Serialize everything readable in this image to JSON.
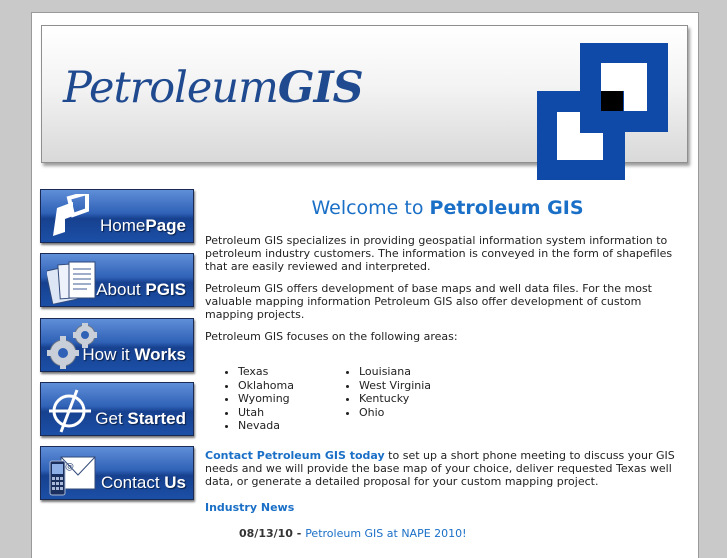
{
  "header": {
    "logo_light": "Petroleum",
    "logo_bold": "GIS"
  },
  "nav": [
    {
      "label_light": "Home",
      "label_bold": "Page",
      "icon": "logo-squares-icon"
    },
    {
      "label_light": "About ",
      "label_bold": "PGIS",
      "icon": "documents-icon"
    },
    {
      "label_light": "How it ",
      "label_bold": "Works",
      "icon": "gears-icon"
    },
    {
      "label_light": "Get ",
      "label_bold": "Started",
      "icon": "crosshair-icon"
    },
    {
      "label_light": "Contact ",
      "label_bold": "Us",
      "icon": "phone-envelope-icon"
    }
  ],
  "main": {
    "title_prefix": "Welcome to ",
    "title_bold": "Petroleum GIS",
    "para1": "Petroleum GIS specializes in providing geospatial information system information to petroleum industry customers. The information is conveyed in the form of shapefiles that are easily reviewed and interpreted.",
    "para2": "Petroleum GIS offers development of base maps and well data files. For the most valuable mapping information Petroleum GIS also offer development of custom mapping projects.",
    "para3": "Petroleum GIS focuses on the following areas:",
    "areas_col1": [
      "Texas",
      "Oklahoma",
      "Wyoming",
      "Utah",
      "Nevada"
    ],
    "areas_col2": [
      "Louisiana",
      "West Virginia",
      "Kentucky",
      "Ohio"
    ],
    "contact_link": "Contact Petroleum GIS today",
    "contact_text": " to set up a short phone meeting to discuss your GIS needs and we will provide the base map of your choice, deliver requested Texas well data, or generate a detailed proposal for your custom mapping project.",
    "news_heading": "Industry News",
    "news_date": "08/13/10 - ",
    "news_link": "Petroleum GIS at NAPE 2010!"
  },
  "colors": {
    "accent": "#1a6fc7",
    "logo_blue": "#1f4a8f",
    "nav_blue": "#2f61b6"
  }
}
